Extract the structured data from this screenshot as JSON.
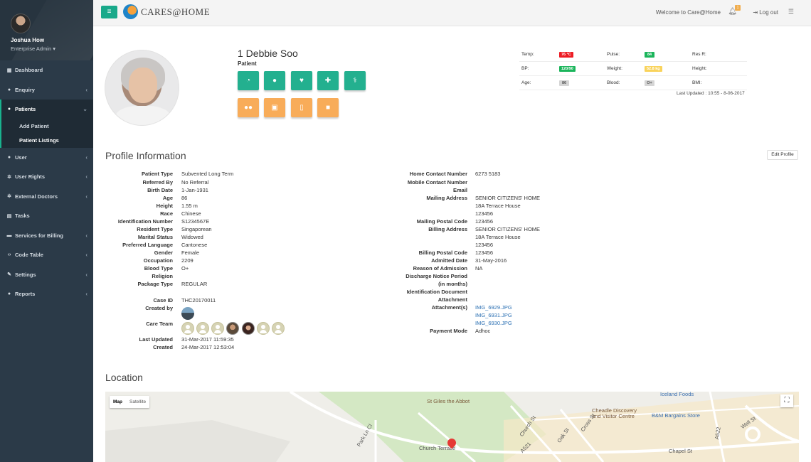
{
  "sidebar": {
    "user_name": "Joshua How",
    "user_role": "Enterprise Admin",
    "items": [
      {
        "label": "Dashboard",
        "icon": "dashboard-icon"
      },
      {
        "label": "Enquiry",
        "icon": "enquiry-icon"
      },
      {
        "label": "Patients",
        "icon": "patients-icon"
      },
      {
        "label": "User",
        "icon": "user-icon"
      },
      {
        "label": "User Rights",
        "icon": "gear-icon"
      },
      {
        "label": "External Doctors",
        "icon": "gear-icon"
      },
      {
        "label": "Tasks",
        "icon": "tasks-icon"
      },
      {
        "label": "Services for Billing",
        "icon": "billing-icon"
      },
      {
        "label": "Code Table",
        "icon": "code-icon"
      },
      {
        "label": "Settings",
        "icon": "wrench-icon"
      },
      {
        "label": "Reports",
        "icon": "reports-icon"
      }
    ],
    "patients_sub": [
      "Add Patient",
      "Patient Listings"
    ]
  },
  "topbar": {
    "logo_text": "CARES@HOME",
    "welcome": "Welcome to Care@Home",
    "notification_count": "1",
    "logout": "Log out"
  },
  "patient": {
    "name": "1 Debbie Soo",
    "label": "Patient"
  },
  "vitals": {
    "temp_label": "Temp:",
    "temp_value": "76 °C",
    "pulse_label": "Pulse:",
    "pulse_value": "84",
    "resr_label": "Res R:",
    "bp_label": "BP:",
    "bp_value": "120/90",
    "weight_label": "Weight:",
    "weight_value": "52.8 kg",
    "height_label": "Height:",
    "age_label": "Age:",
    "age_value": "86",
    "blood_label": "Blood:",
    "blood_value": "O+",
    "bmi_label": "BMI:",
    "last_updated": "Last Updated : 10:55 - 8-06-2017",
    "colors": {
      "red": "#ed1c24",
      "green": "#1bb55b",
      "yellow": "#f9d35b",
      "gray": "#d5d5d5"
    }
  },
  "profile": {
    "title": "Profile Information",
    "edit_label": "Edit Profile",
    "left": {
      "patient_type_l": "Patient Type",
      "patient_type_v": "Subvented Long Term",
      "referred_by_l": "Referred By",
      "referred_by_v": "No Referral",
      "birth_date_l": "Birth Date",
      "birth_date_v": "1-Jan-1931",
      "age_l": "Age",
      "age_v": "86",
      "height_l": "Height",
      "height_v": "1.55 m",
      "race_l": "Race",
      "race_v": "Chinese",
      "id_number_l": "Identification Number",
      "id_number_v": "S1234567E",
      "resident_type_l": "Resident Type",
      "resident_type_v": "Singaporean",
      "marital_l": "Marital Status",
      "marital_v": "Widowed",
      "language_l": "Preferred Language",
      "language_v": "Cantonese",
      "gender_l": "Gender",
      "gender_v": "Female",
      "occupation_l": "Occupation",
      "occupation_v": "2209",
      "blood_type_l": "Blood Type",
      "blood_type_v": "O+",
      "religion_l": "Religion",
      "package_l": "Package Type",
      "package_v": "REGULAR",
      "case_id_l": "Case ID",
      "case_id_v": "THC20170011",
      "created_by_l": "Created by",
      "care_team_l": "Care Team",
      "last_updated_l": "Last Updated",
      "last_updated_v": "31-Mar-2017 11:59:35",
      "created_l": "Created",
      "created_v": "24-Mar-2017 12:53:04"
    },
    "right": {
      "home_contact_l": "Home Contact Number",
      "home_contact_v": "6273 5183",
      "mobile_l": "Mobile Contact Number",
      "email_l": "Email",
      "mailing_addr_l": "Mailing Address",
      "mailing_addr_1": "SENIOR CITIZENS' HOME",
      "mailing_addr_2": "18A Terrace House",
      "mailing_addr_3": "123456",
      "mailing_postal_l": "Mailing Postal Code",
      "mailing_postal_v": "123456",
      "billing_addr_l": "Billing Address",
      "billing_addr_1": "SENIOR CITIZENS' HOME",
      "billing_addr_2": "18A Terrace House",
      "billing_addr_3": "123456",
      "billing_postal_l": "Billing Postal Code",
      "billing_postal_v": "123456",
      "admitted_l": "Admitted Date",
      "admitted_v": "31-May-2016",
      "reason_l": "Reason of Admission",
      "reason_v": "NA",
      "discharge_l1": "Discharge Notice Period",
      "discharge_l2": "(in months)",
      "id_doc_l1": "Identification Document",
      "id_doc_l2": "Attachment",
      "attachments_l": "Attachment(s)",
      "attachments": [
        "IMG_6929.JPG",
        "IMG_6931.JPG",
        "IMG_6930.JPG"
      ],
      "payment_l": "Payment Mode",
      "payment_v": "Adhoc"
    }
  },
  "location": {
    "title": "Location",
    "map_btn": "Map",
    "satellite_btn": "Satellite",
    "labels": [
      "St Giles the Abbot",
      "Iceland Foods",
      "Cheadle Discovery",
      "and Visitor Centre",
      "B&M Bargains Store",
      "Church Terrace",
      "Chapel St",
      "Church St",
      "Cross St",
      "Oak St",
      "Well St",
      "Park Ln Cl",
      "A521",
      "A522"
    ]
  }
}
